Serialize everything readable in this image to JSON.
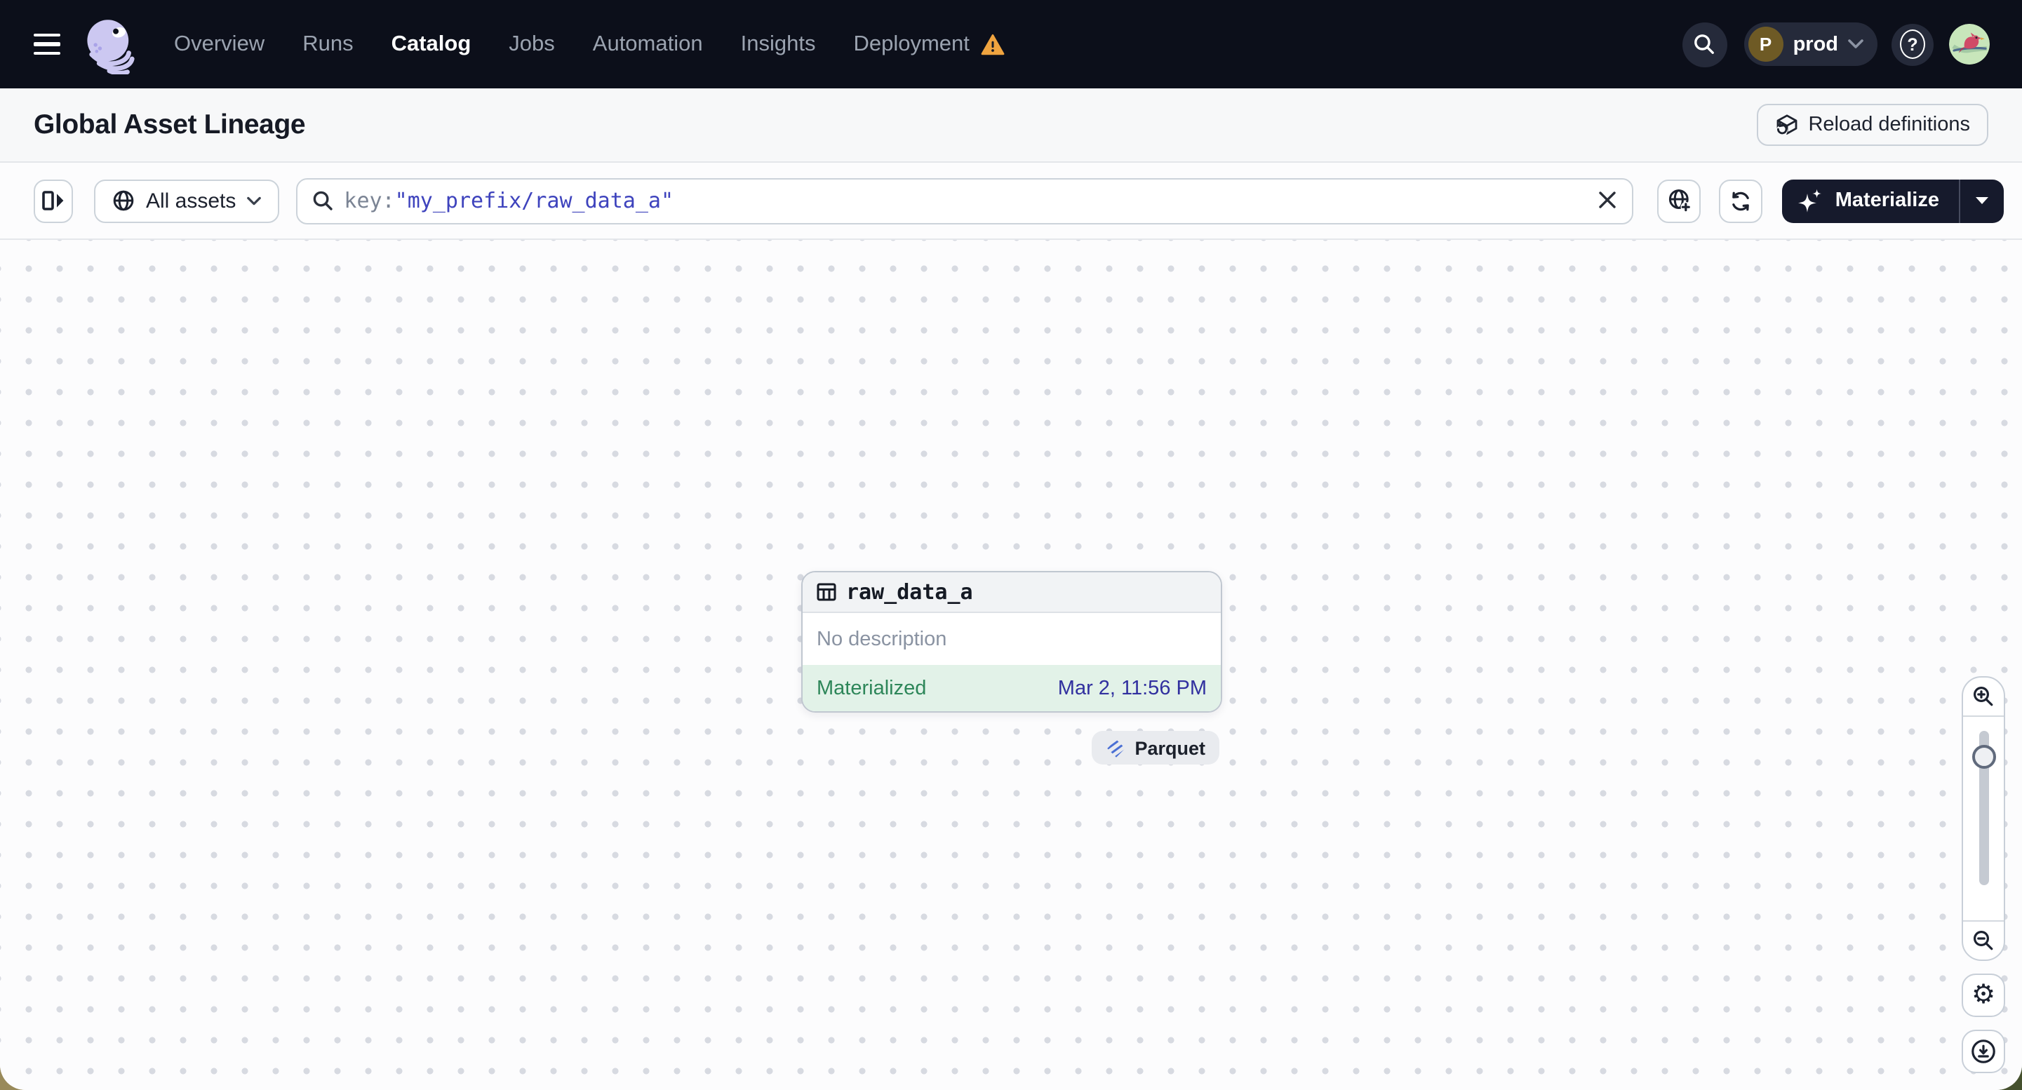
{
  "nav": {
    "items": [
      {
        "label": "Overview",
        "active": false
      },
      {
        "label": "Runs",
        "active": false
      },
      {
        "label": "Catalog",
        "active": true
      },
      {
        "label": "Jobs",
        "active": false
      },
      {
        "label": "Automation",
        "active": false
      },
      {
        "label": "Insights",
        "active": false
      },
      {
        "label": "Deployment",
        "active": false,
        "warning": true
      }
    ],
    "environment": {
      "initial": "P",
      "name": "prod"
    }
  },
  "header": {
    "title": "Global Asset Lineage",
    "reload_button": "Reload definitions"
  },
  "toolbar": {
    "scope_label": "All assets",
    "search": {
      "prefix": "key:",
      "term": "\"my_prefix/raw_data_a\""
    },
    "materialize_label": "Materialize"
  },
  "graph": {
    "node": {
      "name": "raw_data_a",
      "description": "No description",
      "status": "Materialized",
      "timestamp": "Mar 2, 11:56 PM",
      "tag": "Parquet"
    }
  },
  "icons": {
    "hamburger": "three-bars",
    "dagster-logo": "lavender-octopus",
    "warning": "orange-triangle-!",
    "search": "magnifier",
    "help": "?-in-circle",
    "reload": "cube-with-refresh-arrow",
    "panel_toggle": "rect-with-right-arrow",
    "scope": "globe",
    "clear": "x",
    "new_tab_globe": "globe-plus",
    "refresh": "circular-arrows",
    "materialize": "sparkles",
    "asset": "table-grid",
    "tag_logo": "parquet-diamond",
    "zoom_in": "magnifier-plus",
    "zoom_out": "magnifier-minus",
    "settings": "gear ⚙",
    "download": "arrow-down-in-circle"
  },
  "colors": {
    "navbar": "#0c0f1a",
    "navpill": "#252a3a",
    "accent_warning": "#f0a43f",
    "brand_lavender": "#ccc8f1",
    "green_text": "#2d8659",
    "green_bg": "#e2f2e8",
    "indigo_time": "#31309f",
    "indigo_search": "#3e43bd",
    "materialize_bg": "#161a2c",
    "parquet_blue": "#4a6fd4",
    "avatar_brown": "#6e5a25"
  }
}
